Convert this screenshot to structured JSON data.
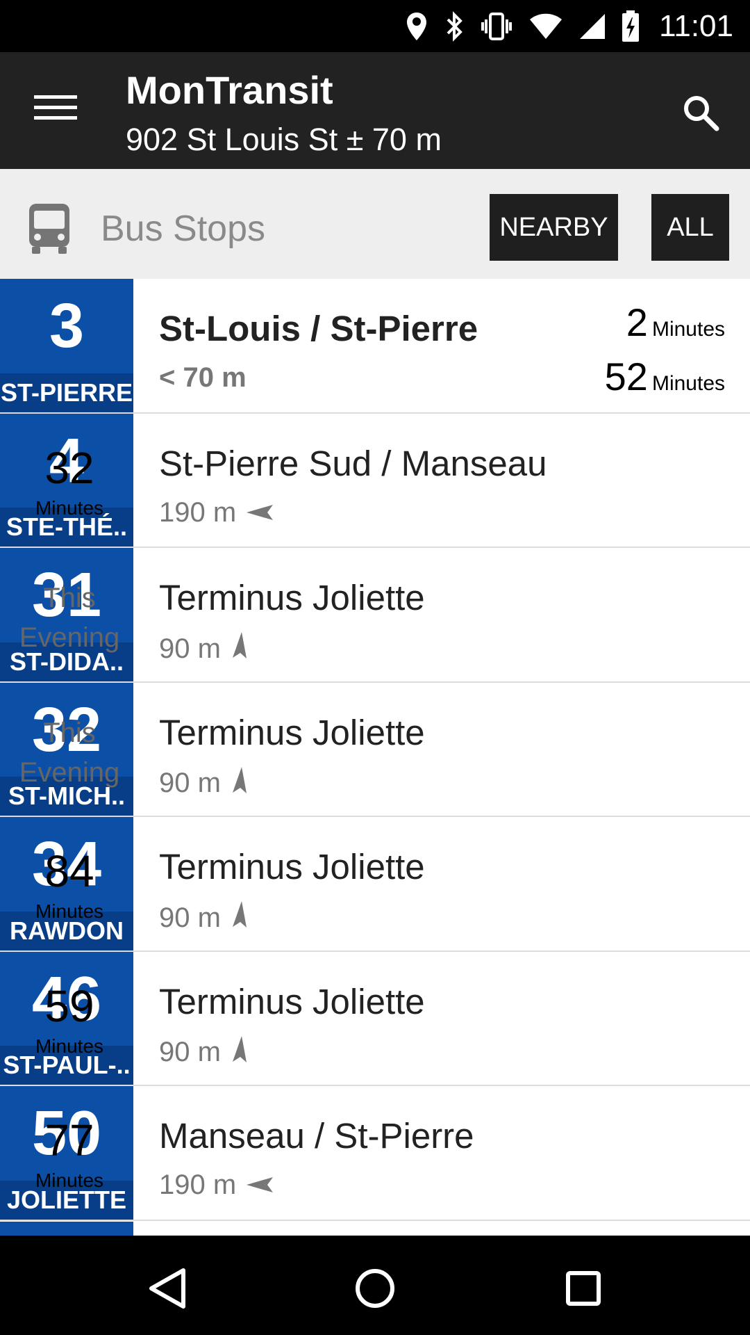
{
  "status_bar": {
    "time": "11:01",
    "icons": [
      "location-icon",
      "bluetooth-icon",
      "vibrate-icon",
      "wifi-icon",
      "signal-icon",
      "battery-charging-icon"
    ]
  },
  "app_bar": {
    "title": "MonTransit",
    "subtitle": "902 St Louis St ± 70 m",
    "icons": [
      "menu-icon",
      "search-icon"
    ]
  },
  "section": {
    "icon": "bus-icon",
    "title": "Bus Stops",
    "nearby_label": "NEARBY",
    "all_label": "ALL"
  },
  "stops": [
    {
      "route": "3",
      "route_name": "ST-PIERRE",
      "stop": "St-Louis / St-Pierre",
      "distance": "< 70 m",
      "arrow": "none",
      "time_type": "double",
      "t1_value": "2",
      "t1_unit": "Minutes",
      "t2_value": "52",
      "t2_unit": "Minutes"
    },
    {
      "route": "4",
      "route_name": "STE-THÉ..",
      "stop": "St-Pierre Sud / Manseau",
      "distance": "190 m",
      "arrow": "west",
      "time_type": "single",
      "value": "32",
      "unit": "Minutes"
    },
    {
      "route": "31",
      "route_name": "ST-DIDA..",
      "stop": "Terminus Joliette",
      "distance": "90 m",
      "arrow": "north",
      "time_type": "text",
      "line1": "This",
      "line2": "Evening"
    },
    {
      "route": "32",
      "route_name": "ST-MICH..",
      "stop": "Terminus Joliette",
      "distance": "90 m",
      "arrow": "north",
      "time_type": "text",
      "line1": "This",
      "line2": "Evening"
    },
    {
      "route": "34",
      "route_name": "RAWDON",
      "stop": "Terminus Joliette",
      "distance": "90 m",
      "arrow": "north",
      "time_type": "single",
      "value": "84",
      "unit": "Minutes"
    },
    {
      "route": "46",
      "route_name": "ST-PAUL-..",
      "stop": "Terminus Joliette",
      "distance": "90 m",
      "arrow": "north",
      "time_type": "single",
      "value": "59",
      "unit": "Minutes"
    },
    {
      "route": "50",
      "route_name": "JOLIETTE",
      "stop": "Manseau / St-Pierre",
      "distance": "190 m",
      "arrow": "west",
      "time_type": "single",
      "value": "77",
      "unit": "Minutes"
    }
  ],
  "nav_bar": {
    "icons": [
      "back-icon",
      "home-icon",
      "recent-apps-icon"
    ]
  },
  "colors": {
    "route_blue": "#0c4fa7",
    "route_name_blue": "#083e88",
    "app_bar": "#222222",
    "section_bg": "#eeeeee"
  }
}
